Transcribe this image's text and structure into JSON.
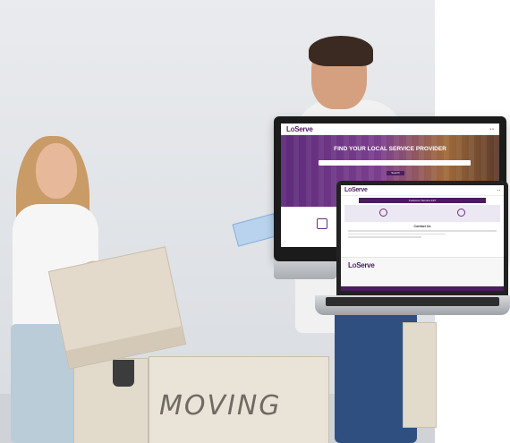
{
  "photo": {
    "box_label": "MOVING"
  },
  "monitor_site": {
    "logo": "LoServe",
    "hero_heading": "FIND YOUR LOCAL SERVICE PROVIDER",
    "search_button": "Search"
  },
  "laptop_site": {
    "logo": "LoServe",
    "cta": "Customer Service 24/7",
    "contact_heading": "Contact Us",
    "footer_logo": "LoServe",
    "colors": {
      "brand": "#4a1d5e"
    }
  }
}
